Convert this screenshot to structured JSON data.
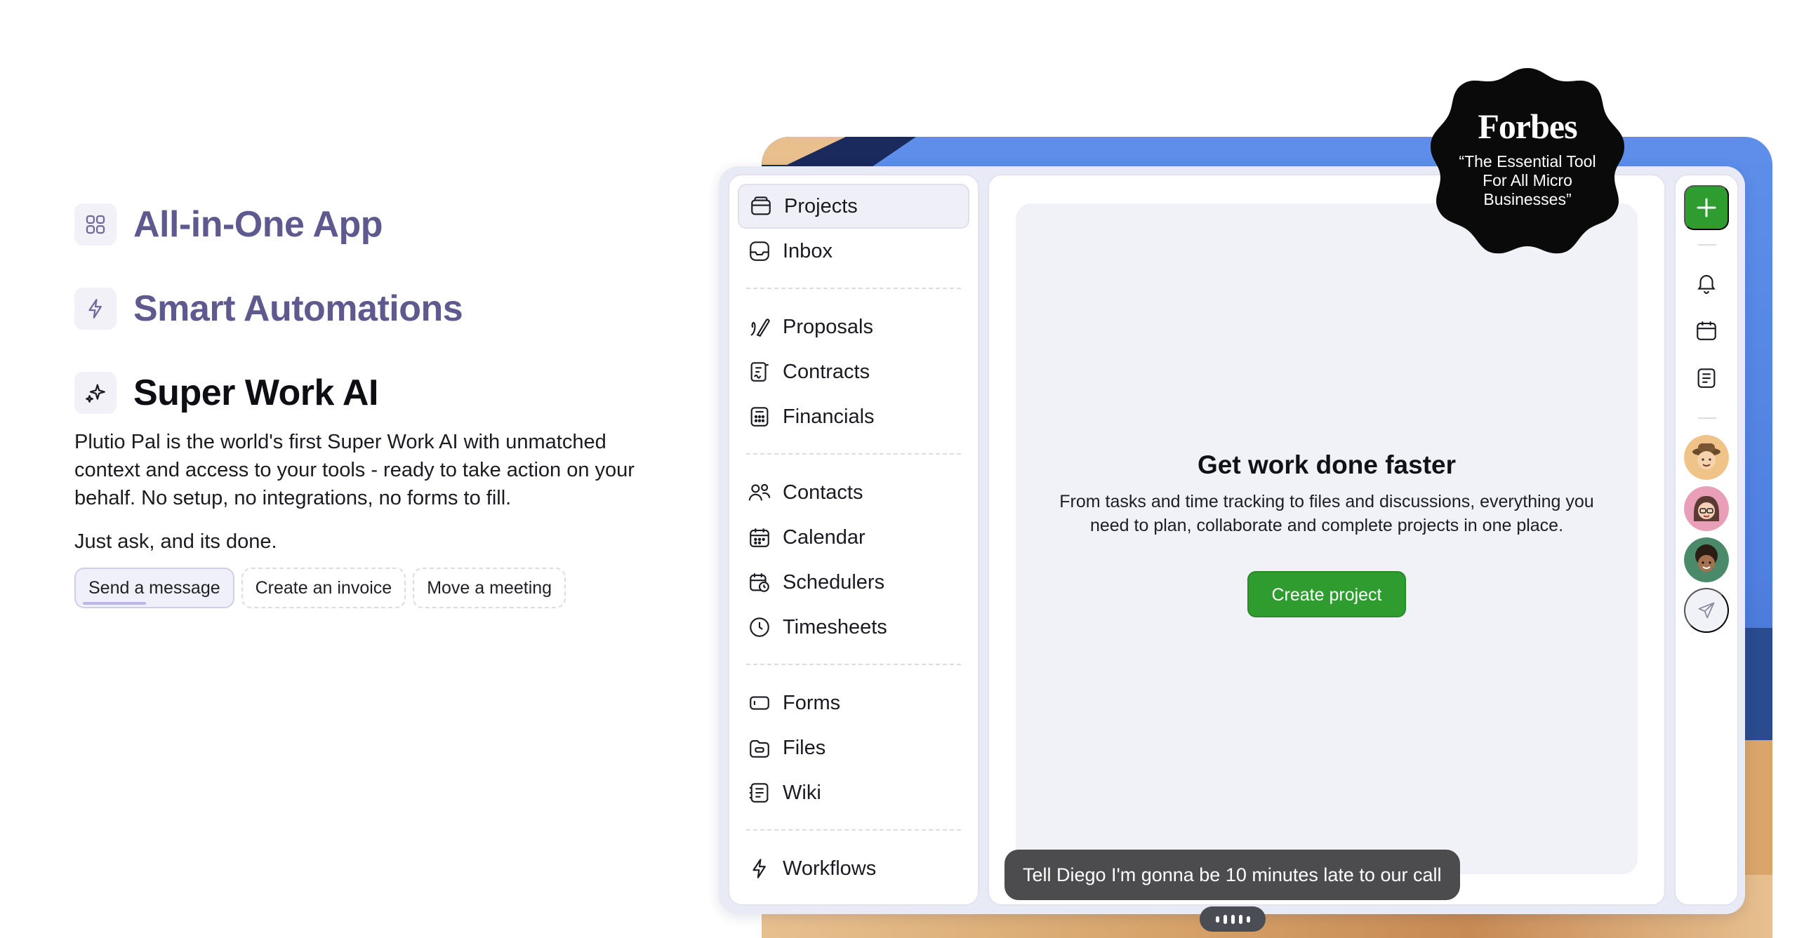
{
  "features": [
    {
      "icon": "grid-icon",
      "title": "All-in-One App"
    },
    {
      "icon": "bolt-icon",
      "title": "Smart Automations"
    },
    {
      "icon": "sparkle-icon",
      "title": "Super Work AI"
    }
  ],
  "ai": {
    "description": "Plutio Pal is the world's first Super Work AI with unmatched context and access to your tools - ready to take action on your behalf. No setup, no integrations, no forms to fill.",
    "ask": "Just ask, and its done.",
    "chips": [
      "Send a message",
      "Create an invoice",
      "Move a meeting"
    ]
  },
  "nav": {
    "items": [
      {
        "label": "Projects",
        "icon": "folder-icon"
      },
      {
        "label": "Inbox",
        "icon": "inbox-icon"
      },
      {
        "label": "Proposals",
        "icon": "pen-icon"
      },
      {
        "label": "Contracts",
        "icon": "contract-icon"
      },
      {
        "label": "Financials",
        "icon": "calculator-icon"
      },
      {
        "label": "Contacts",
        "icon": "users-icon"
      },
      {
        "label": "Calendar",
        "icon": "calendar-icon"
      },
      {
        "label": "Schedulers",
        "icon": "scheduler-icon"
      },
      {
        "label": "Timesheets",
        "icon": "clock-icon"
      },
      {
        "label": "Forms",
        "icon": "form-icon"
      },
      {
        "label": "Files",
        "icon": "file-folder-icon"
      },
      {
        "label": "Wiki",
        "icon": "wiki-icon"
      },
      {
        "label": "Workflows",
        "icon": "bolt-icon"
      }
    ]
  },
  "main": {
    "title": "Get work done faster",
    "description": "From tasks and time tracking to files and discussions, everything you need to plan, collaborate and complete projects in one place.",
    "button": "Create project"
  },
  "toast": "Tell Diego I'm gonna be 10 minutes late to our call",
  "forbes": {
    "brand": "Forbes",
    "quote": "“The Essential Tool For All Micro Businesses”"
  },
  "colors": {
    "accent_green": "#2f9c2f",
    "feature_purple": "#5e5a8f",
    "toast_bg": "#4c4c4f"
  }
}
